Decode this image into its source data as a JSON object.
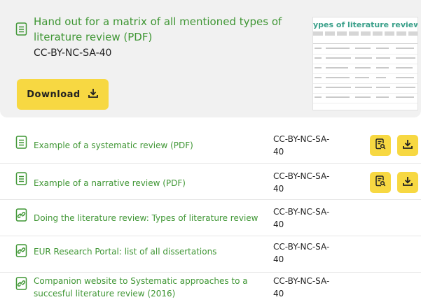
{
  "featured": {
    "title": "Hand out for a matrix of all mentioned types of literature review (PDF)",
    "license": "CC-BY-NC-SA-40",
    "download_label": "Download",
    "icon": "document-icon",
    "thumbnail": {
      "title": "ypes of literature review"
    }
  },
  "resources": [
    {
      "title": "Example of a systematic review (PDF)",
      "license": "CC-BY-NC-SA-40",
      "icon": "document-icon",
      "has_actions": true
    },
    {
      "title": "Example of a narrative review (PDF)",
      "license": "CC-BY-NC-SA-40",
      "icon": "document-icon",
      "has_actions": true
    },
    {
      "title": "Doing the literature review: Types of literature review",
      "license": "CC-BY-NC-SA-40",
      "icon": "link-icon",
      "has_actions": false
    },
    {
      "title": "EUR Research Portal: list of all dissertations",
      "license": "CC-BY-NC-SA-40",
      "icon": "link-icon",
      "has_actions": false
    },
    {
      "title": "Companion website to Systematic approaches to a succesful literature review (2016)",
      "license": "CC-BY-NC-SA-40",
      "icon": "link-icon",
      "has_actions": false
    }
  ],
  "colors": {
    "accent_green": "#3f9634",
    "button_yellow": "#f7d842",
    "panel_gray": "#f1f1f1"
  }
}
